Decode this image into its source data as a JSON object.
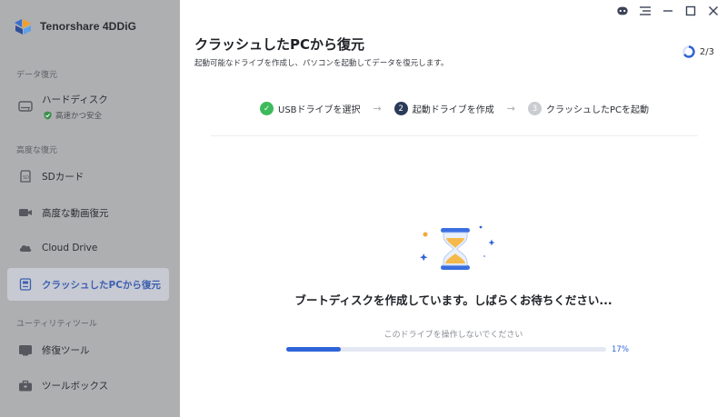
{
  "app": {
    "name": "Tenorshare 4DDiG"
  },
  "sidebar": {
    "section_recovery": "データ復元",
    "section_advanced": "高度な復元",
    "section_utility": "ユーティリティツール",
    "hard_disk": {
      "label": "ハードディスク",
      "note": "高速かつ安全"
    },
    "items": [
      {
        "label": "SDカード",
        "icon": "sd-card-icon"
      },
      {
        "label": "高度な動画復元",
        "icon": "video-icon"
      },
      {
        "label": "Cloud Drive",
        "icon": "cloud-icon"
      },
      {
        "label": "クラッシュしたPCから復元",
        "icon": "pc-crash-icon",
        "active": true
      }
    ],
    "utility_items": [
      {
        "label": "修復ツール",
        "icon": "repair-icon"
      },
      {
        "label": "ツールボックス",
        "icon": "toolbox-icon"
      }
    ]
  },
  "main": {
    "title": "クラッシュしたPCから復元",
    "subtitle": "起動可能なドライブを作成し、パソコンを起動してデータを復元します。",
    "step_counter": "2/3",
    "steps": [
      {
        "num": "✓",
        "label": "USBドライブを選択",
        "state": "done"
      },
      {
        "num": "2",
        "label": "起動ドライブを作成",
        "state": "current"
      },
      {
        "num": "3",
        "label": "クラッシュしたPCを起動",
        "state": "todo"
      }
    ],
    "arrow": "→",
    "status_message": "ブートディスクを作成しています。しばらくお待ちください...",
    "warning": "このドライブを操作しないでください",
    "progress": {
      "percent": 17,
      "label": "17%"
    }
  },
  "colors": {
    "accent": "#2f63d8",
    "done": "#3dbb5c",
    "sidebar_overlay": "#aeafb1"
  }
}
